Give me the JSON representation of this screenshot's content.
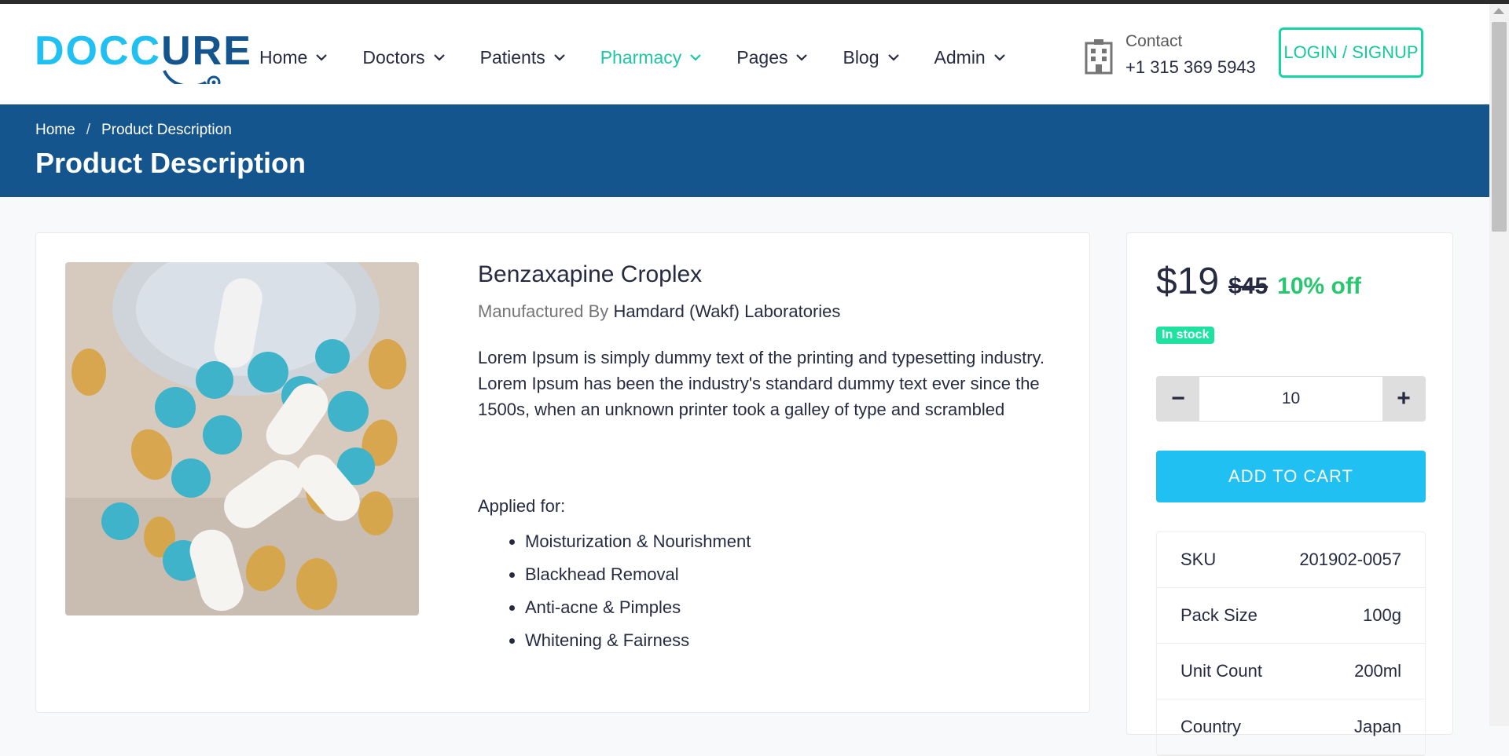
{
  "brand": {
    "logo_part1": "DOCC",
    "logo_part2": "URE",
    "accent": "#20c0f3",
    "dark": "#15558d",
    "green": "#1cc7a3"
  },
  "nav": {
    "items": [
      {
        "label": "Home",
        "active": false
      },
      {
        "label": "Doctors",
        "active": false
      },
      {
        "label": "Patients",
        "active": false
      },
      {
        "label": "Pharmacy",
        "active": true
      },
      {
        "label": "Pages",
        "active": false
      },
      {
        "label": "Blog",
        "active": false
      },
      {
        "label": "Admin",
        "active": false
      }
    ]
  },
  "contact": {
    "label": "Contact",
    "phone": "+1 315 369 5943",
    "icon": "hospital-icon"
  },
  "login_label": "LOGIN / SIGNUP",
  "breadcrumb": {
    "home": "Home",
    "separator": "/",
    "current": "Product Description"
  },
  "page_title": "Product Description",
  "product": {
    "name": "Benzaxapine Croplex",
    "manufactured_by_label": "Manufactured By",
    "manufacturer": "Hamdard (Wakf) Laboratories",
    "description": "Lorem Ipsum is simply dummy text of the printing and typesetting industry. Lorem Ipsum has been the industry's standard dummy text ever since the 1500s, when an unknown printer took a galley of type and scrambled",
    "applied_for_label": "Applied for:",
    "uses": [
      "Moisturization & Nourishment",
      "Blackhead Removal",
      "Anti-acne & Pimples",
      "Whitening & Fairness"
    ],
    "image_icon": "pills-image"
  },
  "purchase": {
    "price": "$19",
    "old_price": "$45",
    "discount": "10% off",
    "stock": "In stock",
    "minus": "−",
    "plus": "+",
    "quantity": "10",
    "add_to_cart": "ADD TO CART",
    "specs": [
      {
        "label": "SKU",
        "value": "201902-0057"
      },
      {
        "label": "Pack Size",
        "value": "100g"
      },
      {
        "label": "Unit Count",
        "value": "200ml"
      },
      {
        "label": "Country",
        "value": "Japan"
      }
    ]
  }
}
